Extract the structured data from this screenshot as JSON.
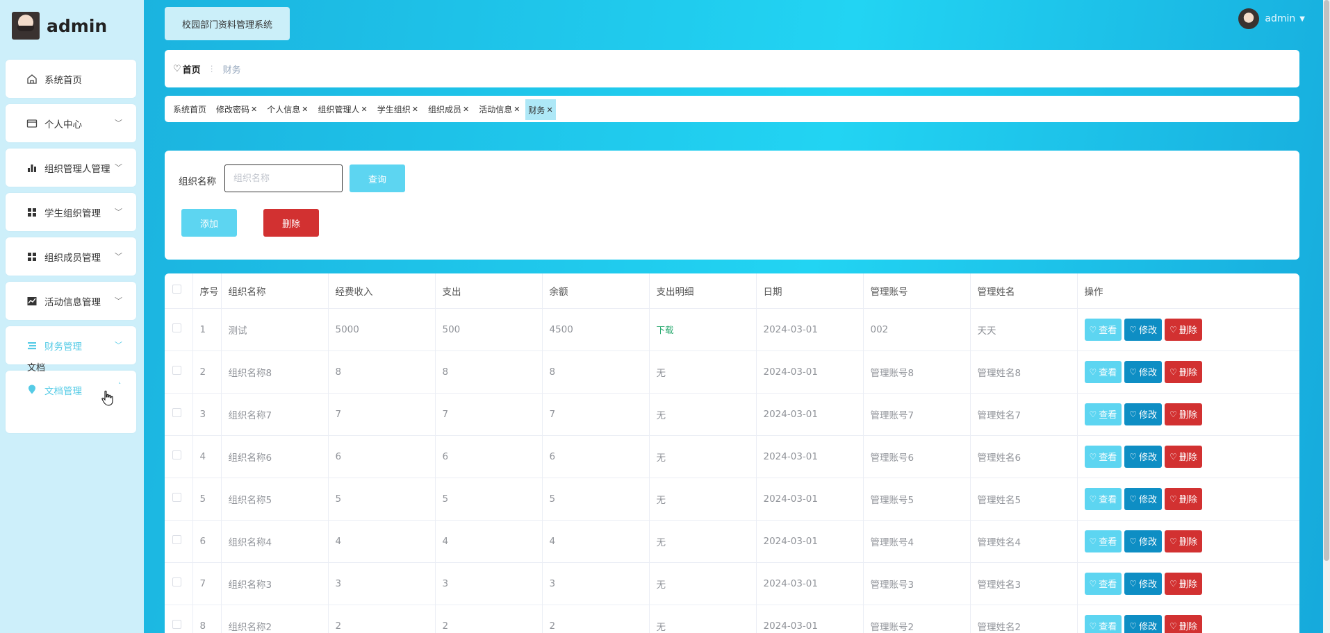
{
  "brand": {
    "name": "admin"
  },
  "sidebar": {
    "items": [
      {
        "label": "系统首页",
        "icon": "home-icon"
      },
      {
        "label": "个人中心",
        "icon": "card-icon",
        "chevron": true
      },
      {
        "label": "组织管理人管理",
        "icon": "bar-chart-icon",
        "chevron": true
      },
      {
        "label": "学生组织管理",
        "icon": "grid-icon",
        "chevron": true
      },
      {
        "label": "组织成员管理",
        "icon": "grid-icon",
        "chevron": true
      },
      {
        "label": "活动信息管理",
        "icon": "line-chart-icon",
        "chevron": true
      },
      {
        "label": "财务管理",
        "icon": "list-icon",
        "chevron": true,
        "active": true
      },
      {
        "label": "文档管理",
        "icon": "location-icon",
        "active": true,
        "expanded": true
      }
    ],
    "submenu_label": "文档"
  },
  "header": {
    "system_title": "校园部门资料管理系统",
    "user_name": "admin"
  },
  "breadcrumb": {
    "home": "首页",
    "separator": "⋮",
    "current": "财务"
  },
  "tags": [
    {
      "label": "系统首页",
      "closable": false
    },
    {
      "label": "修改密码",
      "closable": true
    },
    {
      "label": "个人信息",
      "closable": true
    },
    {
      "label": "组织管理人",
      "closable": true
    },
    {
      "label": "学生组织",
      "closable": true
    },
    {
      "label": "组织成员",
      "closable": true
    },
    {
      "label": "活动信息",
      "closable": true
    },
    {
      "label": "财务",
      "closable": true,
      "active": true
    }
  ],
  "search": {
    "label": "组织名称",
    "placeholder": "组织名称",
    "value": "",
    "query_label": "查询",
    "add_label": "添加",
    "delete_label": "删除"
  },
  "table": {
    "headers": [
      "序号",
      "组织名称",
      "经费收入",
      "支出",
      "余额",
      "支出明细",
      "日期",
      "管理账号",
      "管理姓名",
      "操作"
    ],
    "rows": [
      [
        "1",
        "测试",
        "5000",
        "500",
        "4500",
        "下载",
        "2024-03-01",
        "002",
        "天天"
      ],
      [
        "2",
        "组织名称8",
        "8",
        "8",
        "8",
        "无",
        "2024-03-01",
        "管理账号8",
        "管理姓名8"
      ],
      [
        "3",
        "组织名称7",
        "7",
        "7",
        "7",
        "无",
        "2024-03-01",
        "管理账号7",
        "管理姓名7"
      ],
      [
        "4",
        "组织名称6",
        "6",
        "6",
        "6",
        "无",
        "2024-03-01",
        "管理账号6",
        "管理姓名6"
      ],
      [
        "5",
        "组织名称5",
        "5",
        "5",
        "5",
        "无",
        "2024-03-01",
        "管理账号5",
        "管理姓名5"
      ],
      [
        "6",
        "组织名称4",
        "4",
        "4",
        "4",
        "无",
        "2024-03-01",
        "管理账号4",
        "管理姓名4"
      ],
      [
        "7",
        "组织名称3",
        "3",
        "3",
        "3",
        "无",
        "2024-03-01",
        "管理账号3",
        "管理姓名3"
      ],
      [
        "8",
        "组织名称2",
        "2",
        "2",
        "2",
        "无",
        "2024-03-01",
        "管理账号2",
        "管理姓名2"
      ]
    ],
    "actions": {
      "view": "查看",
      "edit": "修改",
      "delete": "删除"
    }
  },
  "colors": {
    "accent": "#5dd5f1",
    "primary_dark": "#0e8ec4",
    "danger": "#d23131",
    "download_link": "#27a96e"
  }
}
